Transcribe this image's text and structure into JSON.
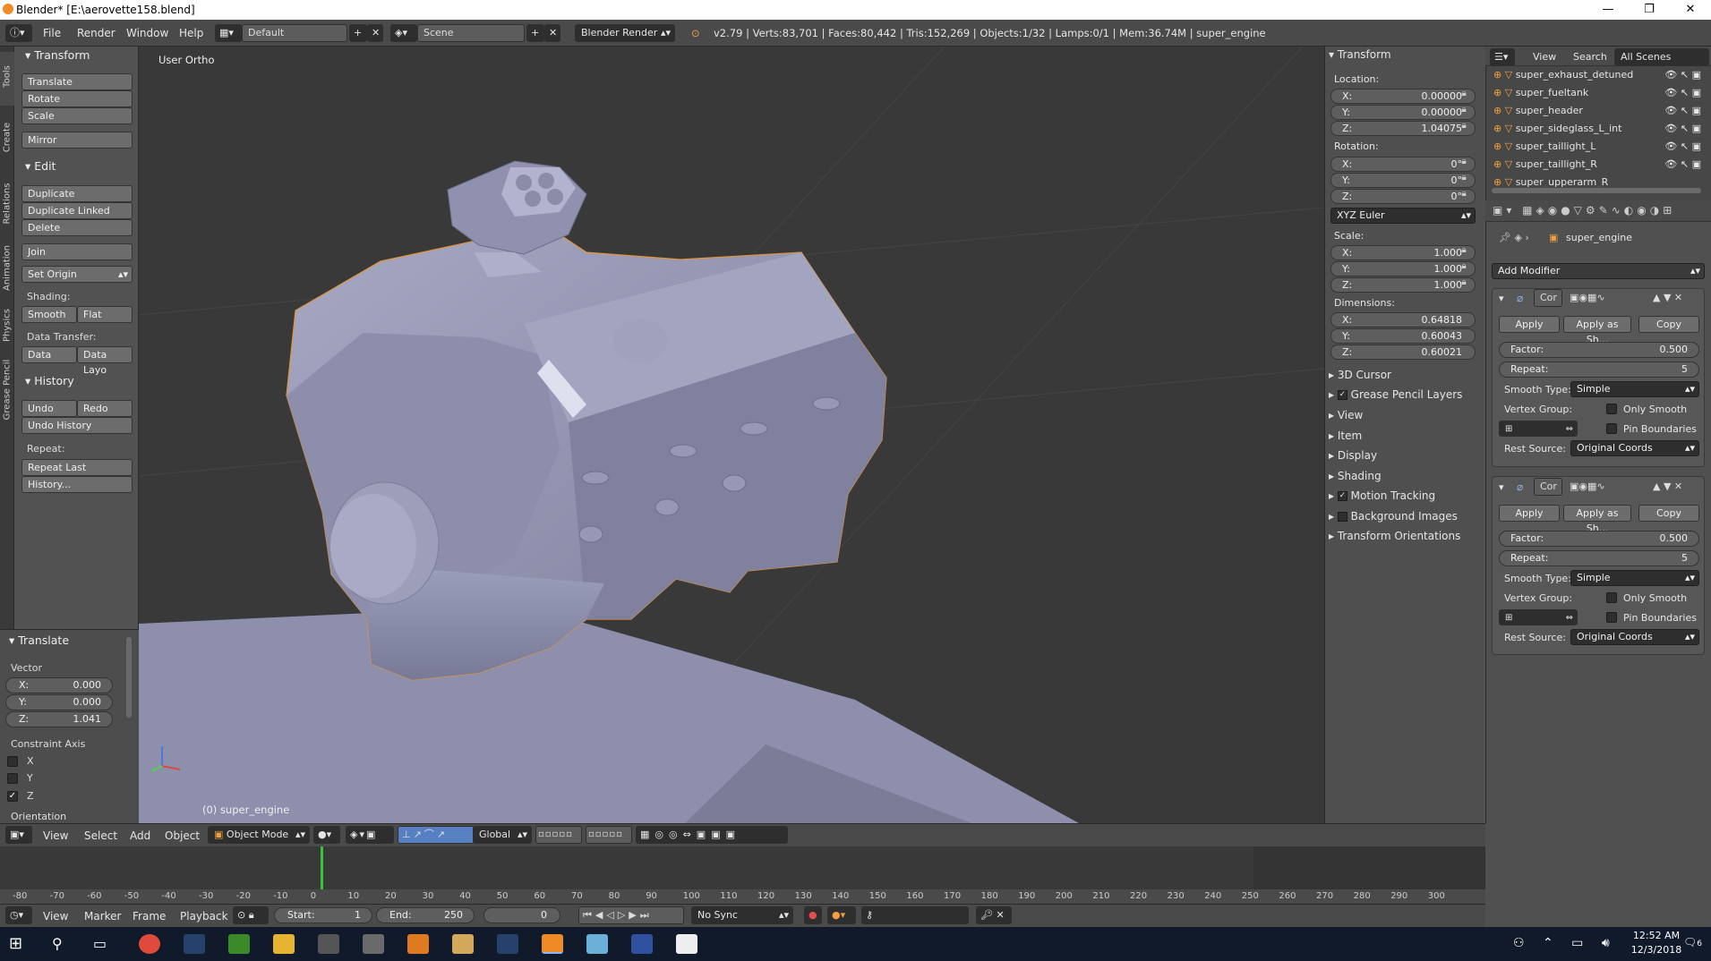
{
  "window": {
    "title": "Blender* [E:\\aerovette158.blend]",
    "minimize": "—",
    "maximize": "❐",
    "close": "✕"
  },
  "topbar": {
    "menus": [
      "File",
      "Render",
      "Window",
      "Help"
    ],
    "screen_layout": "Default",
    "scene": "Scene",
    "engine": "Blender Render",
    "stats": "v2.79 | Verts:83,701 | Faces:80,442 | Tris:152,269 | Objects:1/32 | Lamps:0/1 | Mem:36.74M | super_engine"
  },
  "tabs": [
    "Tools",
    "Create",
    "Relations",
    "Animation",
    "Physics",
    "Grease Pencil"
  ],
  "toolshelf": {
    "transform": {
      "title": "Transform",
      "buttons": [
        "Translate",
        "Rotate",
        "Scale",
        "Mirror"
      ]
    },
    "edit": {
      "title": "Edit",
      "buttons": [
        "Duplicate",
        "Duplicate Linked",
        "Delete",
        "Join",
        "Set Origin"
      ],
      "shading_label": "Shading:",
      "smooth": "Smooth",
      "flat": "Flat",
      "data_transfer_label": "Data Transfer:",
      "data": "Data",
      "data_layo": "Data Layo"
    },
    "history": {
      "title": "History",
      "undo": "Undo",
      "redo": "Redo",
      "undo_history": "Undo History",
      "repeat_label": "Repeat:",
      "repeat_last": "Repeat Last",
      "history_dots": "History..."
    }
  },
  "operator": {
    "title": "Translate",
    "vector_label": "Vector",
    "x": {
      "label": "X:",
      "value": "0.000"
    },
    "y": {
      "label": "Y:",
      "value": "0.000"
    },
    "z": {
      "label": "Z:",
      "value": "1.041"
    },
    "constraint_label": "Constraint Axis",
    "axes": [
      {
        "label": "X",
        "checked": false
      },
      {
        "label": "Y",
        "checked": false
      },
      {
        "label": "Z",
        "checked": true
      }
    ],
    "orientation_label": "Orientation"
  },
  "viewport": {
    "view_name": "User Ortho",
    "object_label": "(0) super_engine"
  },
  "npanel": {
    "transform_title": "Transform",
    "location_label": "Location:",
    "location": [
      {
        "l": "X:",
        "v": "0.00000"
      },
      {
        "l": "Y:",
        "v": "0.00000"
      },
      {
        "l": "Z:",
        "v": "1.04075"
      }
    ],
    "rotation_label": "Rotation:",
    "rotation": [
      {
        "l": "X:",
        "v": "0°"
      },
      {
        "l": "Y:",
        "v": "0°"
      },
      {
        "l": "Z:",
        "v": "0°"
      }
    ],
    "rotation_mode": "XYZ Euler",
    "scale_label": "Scale:",
    "scale": [
      {
        "l": "X:",
        "v": "1.000"
      },
      {
        "l": "Y:",
        "v": "1.000"
      },
      {
        "l": "Z:",
        "v": "1.000"
      }
    ],
    "dimensions_label": "Dimensions:",
    "dimensions": [
      {
        "l": "X:",
        "v": "0.64818"
      },
      {
        "l": "Y:",
        "v": "0.60043"
      },
      {
        "l": "Z:",
        "v": "0.60021"
      }
    ],
    "sections": [
      "3D Cursor",
      "Grease Pencil Layers",
      "View",
      "Item",
      "Display",
      "Shading",
      "Motion Tracking",
      "Background Images",
      "Transform Orientations"
    ],
    "section_checks": {
      "Grease Pencil Layers": true,
      "Motion Tracking": true,
      "Background Images": false
    }
  },
  "outliner": {
    "view": "View",
    "search": "Search",
    "filter": "All Scenes",
    "items": [
      "super_exhaust_detuned",
      "super_fueltank",
      "super_header",
      "super_sideglass_L_int",
      "super_taillight_L",
      "super_taillight_R",
      "super_upperarm_R"
    ]
  },
  "properties": {
    "object_name": "super_engine",
    "add_modifier": "Add Modifier",
    "modifiers": [
      {
        "name": "Cor",
        "apply": "Apply",
        "apply_as": "Apply as Sh...",
        "copy": "Copy",
        "factor_label": "Factor:",
        "factor": "0.500",
        "repeat_label": "Repeat:",
        "repeat": "5",
        "smooth_type_label": "Smooth Type:",
        "smooth_type": "Simple",
        "vertex_group_label": "Vertex Group:",
        "only_smooth": "Only Smooth",
        "pin_boundaries": "Pin Boundaries",
        "rest_source_label": "Rest Source:",
        "rest_source": "Original Coords"
      },
      {
        "name": "Cor",
        "apply": "Apply",
        "apply_as": "Apply as Sh...",
        "copy": "Copy",
        "factor_label": "Factor:",
        "factor": "0.500",
        "repeat_label": "Repeat:",
        "repeat": "5",
        "smooth_type_label": "Smooth Type:",
        "smooth_type": "Simple",
        "vertex_group_label": "Vertex Group:",
        "only_smooth": "Only Smooth",
        "pin_boundaries": "Pin Boundaries",
        "rest_source_label": "Rest Source:",
        "rest_source": "Original Coords"
      }
    ]
  },
  "viewport_header": {
    "menus": [
      "View",
      "Select",
      "Add",
      "Object"
    ],
    "mode": "Object Mode",
    "orientation": "Global"
  },
  "timeline": {
    "ruler": [
      "-80",
      "-70",
      "-60",
      "-50",
      "-40",
      "-30",
      "-20",
      "-10",
      "0",
      "10",
      "20",
      "30",
      "40",
      "50",
      "60",
      "70",
      "80",
      "90",
      "100",
      "110",
      "120",
      "130",
      "140",
      "150",
      "160",
      "170",
      "180",
      "190",
      "200",
      "210",
      "220",
      "230",
      "240",
      "250",
      "260",
      "270",
      "280",
      "290",
      "300"
    ],
    "menus": [
      "View",
      "Marker",
      "Frame",
      "Playback"
    ],
    "start": "Start:",
    "start_val": "1",
    "end": "End:",
    "end_val": "250",
    "current": "0",
    "sync": "No Sync"
  },
  "taskbar": {
    "time": "12:52 AM",
    "date": "12/3/2018",
    "notif": "6"
  }
}
